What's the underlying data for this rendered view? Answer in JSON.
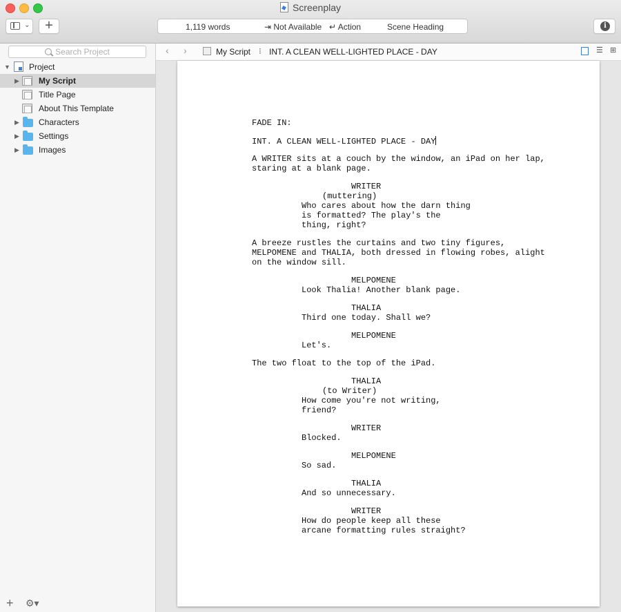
{
  "window": {
    "title": "Screenplay"
  },
  "toolbar": {
    "add_label": "+",
    "word_count": "1,119 words",
    "tab_hint": "⇥ Not Available",
    "return_hint": "↵ Action",
    "current_element": "Scene Heading",
    "info_label": "i"
  },
  "sidebar": {
    "search_placeholder": "Search Project",
    "root_label": "Project",
    "items": [
      {
        "label": "My Script",
        "icon": "script-icon",
        "selected": true,
        "expandable": true
      },
      {
        "label": "Title Page",
        "icon": "script-icon",
        "selected": false,
        "expandable": false
      },
      {
        "label": "About This Template",
        "icon": "script-icon",
        "selected": false,
        "expandable": false
      },
      {
        "label": "Characters",
        "icon": "folder-icon",
        "selected": false,
        "expandable": true
      },
      {
        "label": "Settings",
        "icon": "folder-icon",
        "selected": false,
        "expandable": true
      },
      {
        "label": "Images",
        "icon": "folder-icon",
        "selected": false,
        "expandable": true
      }
    ],
    "footer": {
      "add": "+",
      "gear": "⚙▾"
    }
  },
  "navbar": {
    "back": "‹",
    "forward": "›",
    "document": "My Script",
    "separator": "⁝",
    "scene": "INT. A CLEAN WELL-LIGHTED PLACE - DAY"
  },
  "script": [
    {
      "type": "transition",
      "text": "FADE IN:"
    },
    {
      "type": "scene",
      "text": "INT. A CLEAN WELL-LIGHTED PLACE - DAY"
    },
    {
      "type": "action",
      "text": "A WRITER sits at a couch by the window, an iPad on her lap,\nstaring at a blank page."
    },
    {
      "type": "character",
      "text": "WRITER"
    },
    {
      "type": "parenthetical",
      "text": "(muttering)"
    },
    {
      "type": "dialogue",
      "text": "Who cares about how the darn thing\nis formatted? The play's the\nthing, right?"
    },
    {
      "type": "action",
      "text": "A breeze rustles the curtains and two tiny figures,\nMELPOMENE and THALIA, both dressed in flowing robes, alight\non the window sill."
    },
    {
      "type": "character",
      "text": "MELPOMENE"
    },
    {
      "type": "dialogue",
      "text": "Look Thalia! Another blank page."
    },
    {
      "type": "character",
      "text": "THALIA"
    },
    {
      "type": "dialogue",
      "text": "Third one today. Shall we?"
    },
    {
      "type": "character",
      "text": "MELPOMENE"
    },
    {
      "type": "dialogue",
      "text": "Let's."
    },
    {
      "type": "action",
      "text": "The two float to the top of the iPad."
    },
    {
      "type": "character",
      "text": "THALIA"
    },
    {
      "type": "parenthetical",
      "text": "(to Writer)"
    },
    {
      "type": "dialogue",
      "text": "How come you're not writing,\nfriend?"
    },
    {
      "type": "character",
      "text": "WRITER"
    },
    {
      "type": "dialogue",
      "text": "Blocked."
    },
    {
      "type": "character",
      "text": "MELPOMENE"
    },
    {
      "type": "dialogue",
      "text": "So sad."
    },
    {
      "type": "character",
      "text": "THALIA"
    },
    {
      "type": "dialogue",
      "text": "And so unnecessary."
    },
    {
      "type": "character",
      "text": "WRITER"
    },
    {
      "type": "dialogue",
      "text": "How do people keep all these\narcane formatting rules straight?"
    }
  ]
}
